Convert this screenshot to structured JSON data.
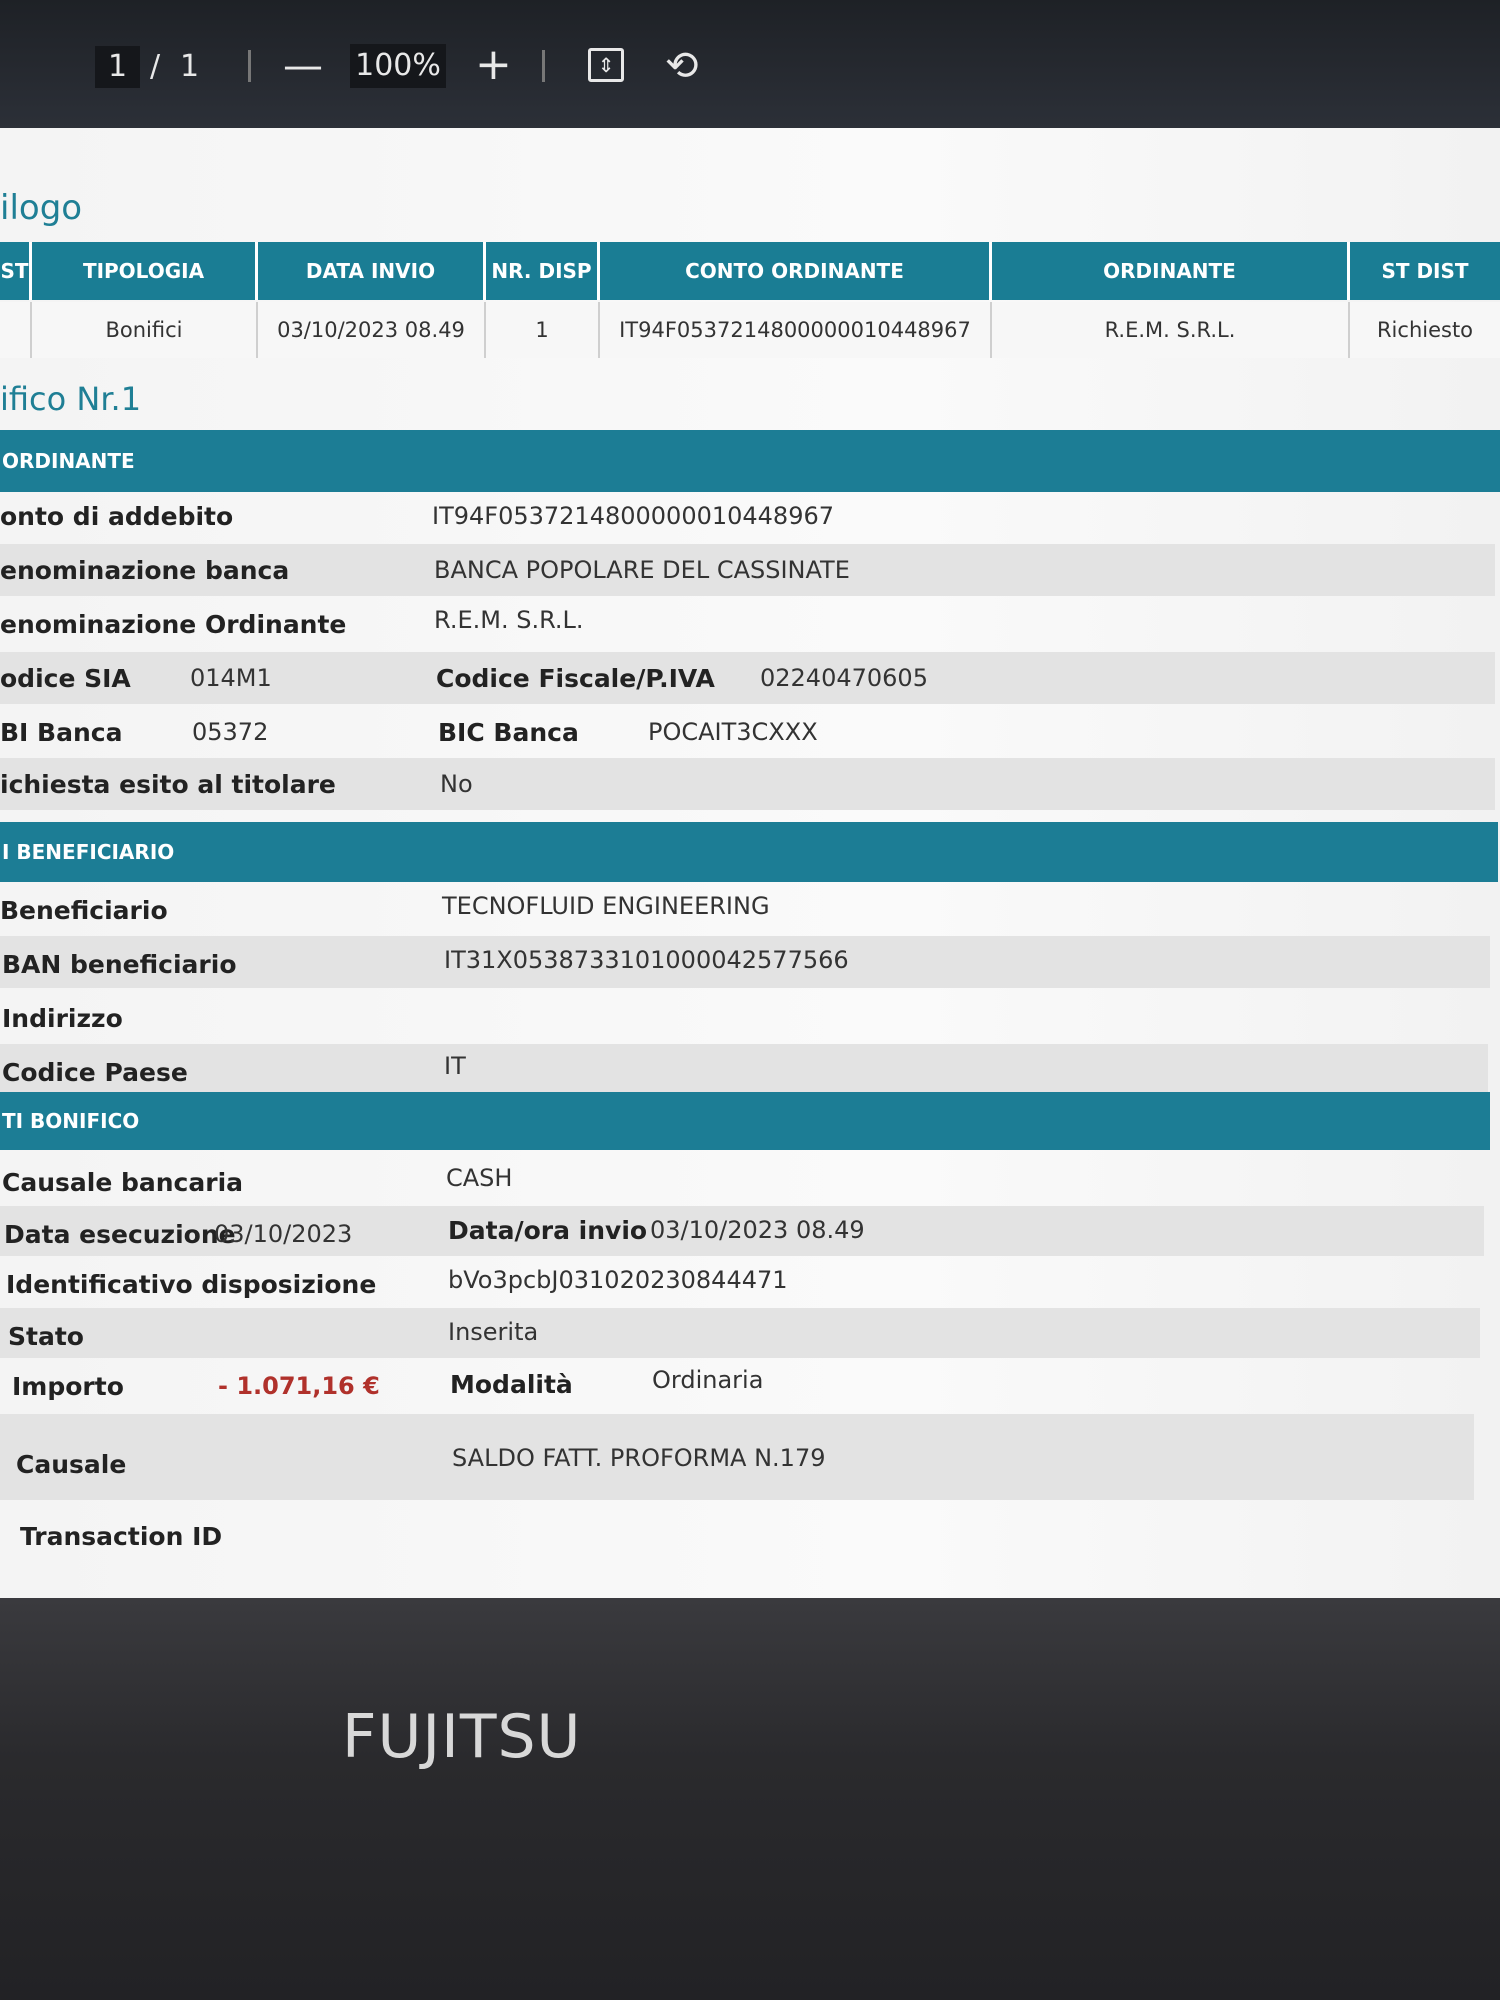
{
  "toolbar": {
    "current_page": "1",
    "page_separator": "/",
    "total_pages": "1",
    "zoom_out": "—",
    "zoom_level": "100%",
    "zoom_in": "+",
    "fit_icon": "⇕",
    "rotate_icon": "⟲"
  },
  "summary": {
    "title": "ilogo",
    "headers": [
      "ST",
      "TIPOLOGIA",
      "DATA INVIO",
      "NR. DISP",
      "CONTO ORDINANTE",
      "ORDINANTE",
      "ST DIST"
    ],
    "row": [
      "",
      "Bonifici",
      "03/10/2023 08.49",
      "1",
      "IT94F0537214800000010448967",
      "R.E.M. S.R.L.",
      "Richiesto"
    ]
  },
  "transfer": {
    "title": "ifico Nr.1",
    "ordinante": {
      "band": "ORDINANTE",
      "conto_label": "onto di addebito",
      "conto_value": "IT94F0537214800000010448967",
      "banca_label": "enominazione banca",
      "banca_value": "BANCA POPOLARE DEL CASSINATE",
      "ordinante_label": "enominazione Ordinante",
      "ordinante_value": "R.E.M. S.R.L.",
      "sia_label": "odice SIA",
      "sia_value": "014M1",
      "cf_label": "Codice Fiscale/P.IVA",
      "cf_value": "02240470605",
      "abi_label": "BI Banca",
      "abi_value": "05372",
      "bic_label": "BIC Banca",
      "bic_value": "POCAIT3CXXX",
      "esito_label": "ichiesta esito al titolare",
      "esito_value": "No"
    },
    "beneficiario": {
      "band": "I BENEFICIARIO",
      "nome_label": "Beneficiario",
      "nome_value": "TECNOFLUID ENGINEERING",
      "iban_label": "BAN beneficiario",
      "iban_value": "IT31X0538733101000042577566",
      "indirizzo_label": "Indirizzo",
      "indirizzo_value": "",
      "paese_label": "Codice Paese",
      "paese_value": "IT"
    },
    "bonifico": {
      "band": "TI BONIFICO",
      "causale_bancaria_label": "Causale bancaria",
      "causale_bancaria_value": "CASH",
      "data_esec_label": "Data esecuzione",
      "data_esec_value": "03/10/2023",
      "data_invio_label": "Data/ora invio",
      "data_invio_value": "03/10/2023 08.49",
      "ident_label": "Identificativo disposizione",
      "ident_value": "bVo3pcbJ031020230844471",
      "stato_label": "Stato",
      "stato_value": "Inserita",
      "importo_label": "Importo",
      "importo_value": "- 1.071,16 €",
      "modalita_label": "Modalità",
      "modalita_value": "Ordinaria",
      "causale_label": "Causale",
      "causale_value": "SALDO FATT. PROFORMA N.179",
      "txid_label": "Transaction ID",
      "txid_value": ""
    }
  },
  "bezel": {
    "brand": "FUJITSU"
  }
}
